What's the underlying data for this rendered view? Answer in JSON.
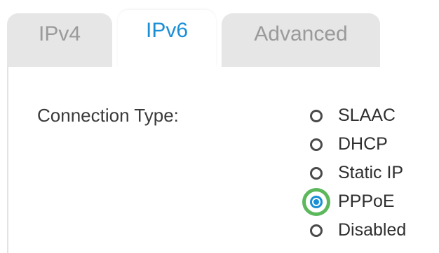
{
  "tabs": [
    {
      "label": "IPv4",
      "active": false
    },
    {
      "label": "IPv6",
      "active": true
    },
    {
      "label": "Advanced",
      "active": false
    }
  ],
  "connection_type": {
    "label": "Connection Type:",
    "options": [
      {
        "label": "SLAAC",
        "selected": false
      },
      {
        "label": "DHCP",
        "selected": false
      },
      {
        "label": "Static IP",
        "selected": false
      },
      {
        "label": "PPPoE",
        "selected": true
      },
      {
        "label": "Disabled",
        "selected": false
      }
    ],
    "highlight_color": "#5cb85c"
  },
  "colors": {
    "accent": "#1a8fd6",
    "inactive_tab_bg": "#e6e6e6",
    "inactive_tab_text": "#9a9a9a"
  }
}
